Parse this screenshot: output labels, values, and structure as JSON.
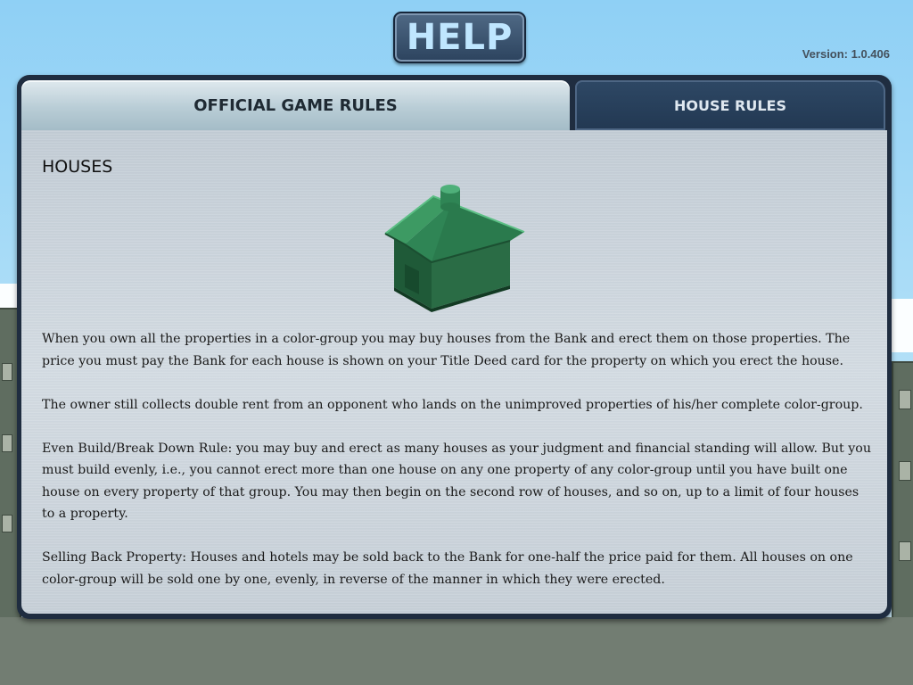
{
  "header": {
    "title": "HELP",
    "version": "Version: 1.0.406"
  },
  "tabs": [
    {
      "label": "OFFICIAL GAME RULES",
      "active": true
    },
    {
      "label": "HOUSE RULES",
      "active": false
    }
  ],
  "section": {
    "title": "HOUSES",
    "image_icon": "green-house-icon",
    "paragraphs": [
      "When you own all the properties in a color-group you may buy houses from the Bank and erect them on those properties.  The price you must pay the Bank for each house is shown on your Title Deed card for the property on which you erect the house.",
      "The owner still collects double rent from an opponent who lands on the unimproved properties of his/her complete color-group.",
      "Even Build/Break Down Rule: you may buy and erect as many houses as your judgment and financial standing will allow.  But you must build evenly, i.e., you cannot erect more than one house on any one property of any color-group until you have built one house on every property of that group.  You may then begin on the second row of houses, and so on, up to a limit of four houses to a property.",
      "Selling Back Property: Houses and hotels may be sold back to the Bank for one-half the price paid for them. All houses on one color-group will be sold one by one, evenly, in reverse of the manner in which they were erected."
    ]
  },
  "colors": {
    "sky": "#8fd0f5",
    "panel_frame": "#1f2d40",
    "house_green": "#2e7d4f"
  }
}
